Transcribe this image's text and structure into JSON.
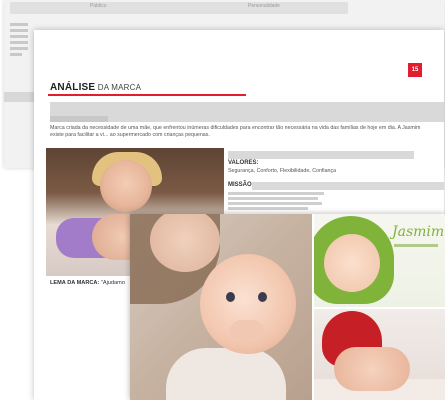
{
  "back_sheet": {
    "header_left": "Público",
    "header_right": "Personalidade"
  },
  "main_page": {
    "page_number": "15",
    "title_bold": "ANÁLISE",
    "title_rest": " DA MARCA",
    "paragraph": "Marca criada da necessidade de uma mãe, que enfrentou inúmeras dificuldades para encontrar tão necessária na vida das famílias de hoje em dia. A Jasmim existe para facilitar a vi... ao supermercado com crianças pequenas.",
    "valores_label": "VALORES:",
    "valores_text": "Segurança, Conforto, Flexibilidade, Confiança",
    "missao_label": "MISSÃO",
    "lema_label": "LEMA DA MARCA:",
    "lema_text": "\"Ajudamo"
  },
  "collage": {
    "logo_text": "Jasmim"
  },
  "colors": {
    "accent_red": "#e11d2e",
    "logo_green": "#7fb33a"
  }
}
